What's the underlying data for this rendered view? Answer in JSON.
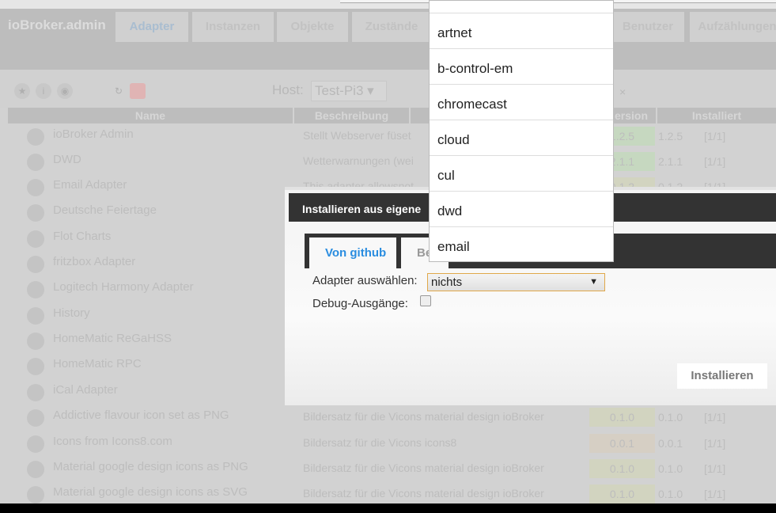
{
  "app": {
    "title": "ioBroker.admin"
  },
  "tabs": [
    {
      "label": "Adapter",
      "active": true
    },
    {
      "label": "Instanzen"
    },
    {
      "label": "Objekte"
    },
    {
      "label": "Zustände"
    },
    {
      "label": "Benutzer"
    },
    {
      "label": "Aufzählungen"
    }
  ],
  "toolbar": {
    "host_label": "Host:",
    "host_value": "Test-Pi3 ▾",
    "close": "×",
    "icons": [
      "star-icon",
      "info-icon",
      "github-icon",
      "refresh-icon",
      "upload-icon"
    ]
  },
  "table": {
    "headers": {
      "name": "Name",
      "description": "Beschreibung",
      "version": "ersion",
      "installed": "Installiert"
    },
    "rows": [
      {
        "name": "ioBroker Admin",
        "desc": "Stellt Webserver füset",
        "v": "1.2.5",
        "iv": "1.2.5",
        "inst": "[1/1]",
        "vcolor": "#c6d8c0"
      },
      {
        "name": "DWD",
        "desc": "Wetterwarnungen (wei",
        "v": "2.1.1",
        "iv": "2.1.1",
        "inst": "[1/1]",
        "vcolor": "#c6d8c0"
      },
      {
        "name": "Email Adapter",
        "desc": "This adapter allowsnot",
        "v": "0.1.2",
        "iv": "0.1.2",
        "inst": "[1/1]",
        "vcolor": "#d2d4c0"
      },
      {
        "name": "Deutsche Feiertage"
      },
      {
        "name": "Flot Charts"
      },
      {
        "name": "fritzbox Adapter"
      },
      {
        "name": "Logitech Harmony Adapter"
      },
      {
        "name": "History"
      },
      {
        "name": "HomeMatic ReGaHSS"
      },
      {
        "name": "HomeMatic RPC"
      },
      {
        "name": "iCal Adapter"
      },
      {
        "name": "Addictive flavour icon set as PNG",
        "desc": "Bildersatz für die Vicons material design ioBroker",
        "v": "0.1.0",
        "iv": "0.1.0",
        "inst": "[1/1]",
        "vcolor": "#d2d4c0"
      },
      {
        "name": "Icons from Icons8.com",
        "desc": "Bildersatz für die Vicons icons8",
        "v": "0.0.1",
        "iv": "0.0.1",
        "inst": "[1/1]",
        "vcolor": "#d6cfc4"
      },
      {
        "name": "Material google design icons as PNG",
        "desc": "Bildersatz für die Vicons material design ioBroker",
        "v": "0.1.0",
        "iv": "0.1.0",
        "inst": "[1/1]",
        "vcolor": "#d2d4c0"
      },
      {
        "name": "Material google design icons as SVG",
        "desc": "Bildersatz für die Vicons material design ioBroker",
        "v": "0.1.0",
        "iv": "0.1.0",
        "inst": "[1/1]",
        "vcolor": "#d2d4c0"
      }
    ]
  },
  "dialog": {
    "title": "Installieren aus eigene",
    "tab_github": "Von github",
    "tab_other": "Be",
    "adapter_label": "Adapter auswählen:",
    "adapter_value": "nichts",
    "debug_label": "Debug-Ausgänge:",
    "install_button": "Installieren",
    "accent": "#2a8de0"
  },
  "dropdown": {
    "options": [
      "",
      "artnet",
      "b-control-em",
      "chromecast",
      "cloud",
      "cul",
      "dwd",
      "email",
      ""
    ]
  }
}
